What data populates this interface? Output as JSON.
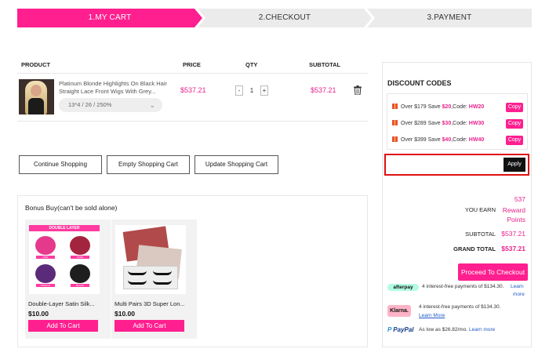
{
  "steps": [
    "1.MY CART",
    "2.CHECKOUT",
    "3.PAYMENT"
  ],
  "cart": {
    "headers": {
      "product": "PRODUCT",
      "price": "PRICE",
      "qty": "QTY",
      "subtotal": "SUBTOTAL"
    },
    "item": {
      "name_line1": "Platinum Blonde Highlights On Black Hair",
      "name_line2": "Straight Lace Front Wigs With Grey...",
      "variant": "13*4 / 26 / 250%",
      "price": "$537.21",
      "qty_minus": "-",
      "qty": "1",
      "qty_plus": "+",
      "subtotal": "$537.21"
    },
    "buttons": {
      "continue": "Continue Shopping",
      "empty": "Empty Shopping Cart",
      "update": "Update Shopping Cart"
    }
  },
  "bonus": {
    "title": "Bonus Buy(can't be sold alone)",
    "products": [
      {
        "title": "Double-Layer Satin Silk...",
        "price": "$10.00",
        "cta": "Add To Cart",
        "banner": "DOUBLE LAYER",
        "tags": [
          "PINK",
          "WINE",
          "PURPLE",
          "BLACK"
        ]
      },
      {
        "title": "Multi Pairs 3D Super Lon...",
        "price": "$10.00",
        "cta": "Add To Cart"
      }
    ]
  },
  "discount": {
    "title": "DISCOUNT CODES",
    "codes": [
      {
        "prefix": "Over $179 Save ",
        "amount": "$20",
        "mid": ",Code: ",
        "code": "HW20",
        "copy": "Copy"
      },
      {
        "prefix": "Over $289 Save ",
        "amount": "$30",
        "mid": ",Code: ",
        "code": "HW30",
        "copy": "Copy"
      },
      {
        "prefix": "Over $399 Save ",
        "amount": "$40",
        "mid": ",Code: ",
        "code": "HW40",
        "copy": "Copy"
      }
    ],
    "input_placeholder": "",
    "apply": "Apply"
  },
  "summary": {
    "earn_label": "YOU EARN",
    "earn_points": "537",
    "earn_reward": "Reward",
    "earn_unit": "Points",
    "subtotal_label": "SUBTOTAL",
    "subtotal": "$537.21",
    "grand_label": "GRAND TOTAL",
    "grand": "$537.21",
    "checkout": "Proceed To Checkout"
  },
  "payments": {
    "afterpay_logo": "afterpay",
    "afterpay_text": "4 interest-free payments of $134.30.",
    "afterpay_link1": "Learn",
    "afterpay_link2": "more",
    "klarna_logo": "Klarna.",
    "klarna_text": "4 interest-free payments of $134.30.",
    "klarna_link": "Learn More",
    "paypal_logo": "PayPal",
    "paypal_text": "As low as $26.82/mo.",
    "paypal_link": "Learn more"
  },
  "colors": {
    "accent": "#ff1f8f",
    "price": "#e8238b",
    "highlight_border": "#e01010"
  }
}
